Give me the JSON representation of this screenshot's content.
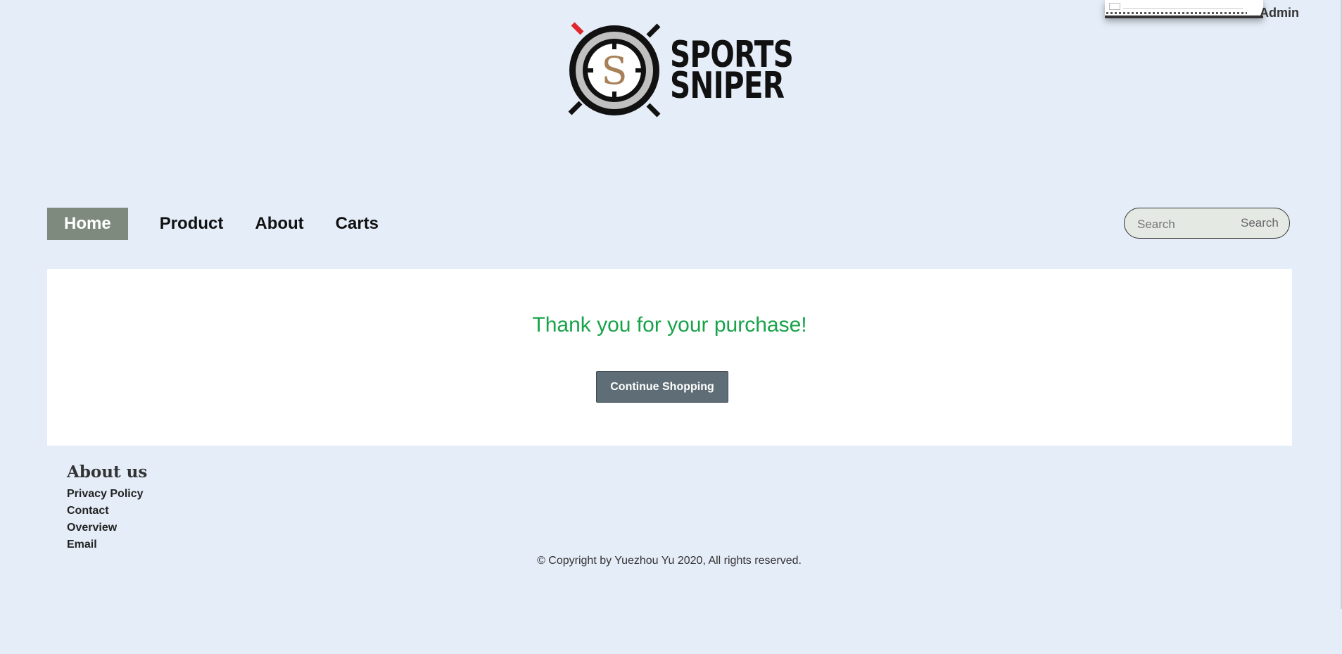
{
  "header": {
    "admin_label": "Admin",
    "logo": {
      "line1": "SPORTS",
      "line2": "SNIPER",
      "monogram": "S"
    }
  },
  "nav": {
    "items": [
      {
        "label": "Home",
        "active": true
      },
      {
        "label": "Product"
      },
      {
        "label": "About"
      },
      {
        "label": "Carts"
      }
    ]
  },
  "search": {
    "placeholder": "Search",
    "button_label": "Search"
  },
  "main": {
    "message": "Thank you for your purchase!",
    "continue_label": "Continue Shopping"
  },
  "footer": {
    "title": "About us",
    "links": [
      "Privacy Policy",
      "Contact",
      "Overview",
      "Email"
    ],
    "copyright": "© Copyright by Yuezhou Yu 2020, All rights reserved."
  },
  "colors": {
    "page_bg": "#e5edf8",
    "nav_active_bg": "#7f8a7f",
    "success_text": "#18a34a",
    "button_bg": "#5f6e76",
    "logo_accent": "#e0262b"
  }
}
